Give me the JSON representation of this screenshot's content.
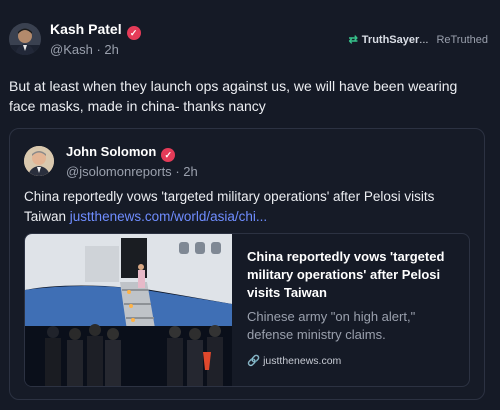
{
  "post": {
    "author": {
      "name": "Kash Patel",
      "handle": "@Kash",
      "time": "2h"
    },
    "retruth": {
      "user": "TruthSayer",
      "ellipsis": "...",
      "label": "ReTruthed"
    },
    "text": "But at least when they launch ops against us, we will have been wearing face masks, made in china- thanks nancy"
  },
  "quote": {
    "author": {
      "name": "John Solomon",
      "handle": "@jsolomonreports",
      "time": "2h"
    },
    "text": "China reportedly vows 'targeted military operations' after Pelosi visits Taiwan",
    "link_text": "justthenews.com/world/asia/chi..."
  },
  "card": {
    "title": "China reportedly vows 'targeted military operations' after Pelosi visits Taiwan",
    "description": "Chinese army \"on high alert,\" defense ministry claims.",
    "domain": "justthenews.com"
  },
  "icons": {
    "verified": "check-badge-icon",
    "retruth": "retruth-arrows-icon",
    "link": "link-icon"
  },
  "colors": {
    "background": "#151a26",
    "verified": "#e53b58",
    "link": "#6f8dff",
    "retruth": "#37c28b"
  }
}
